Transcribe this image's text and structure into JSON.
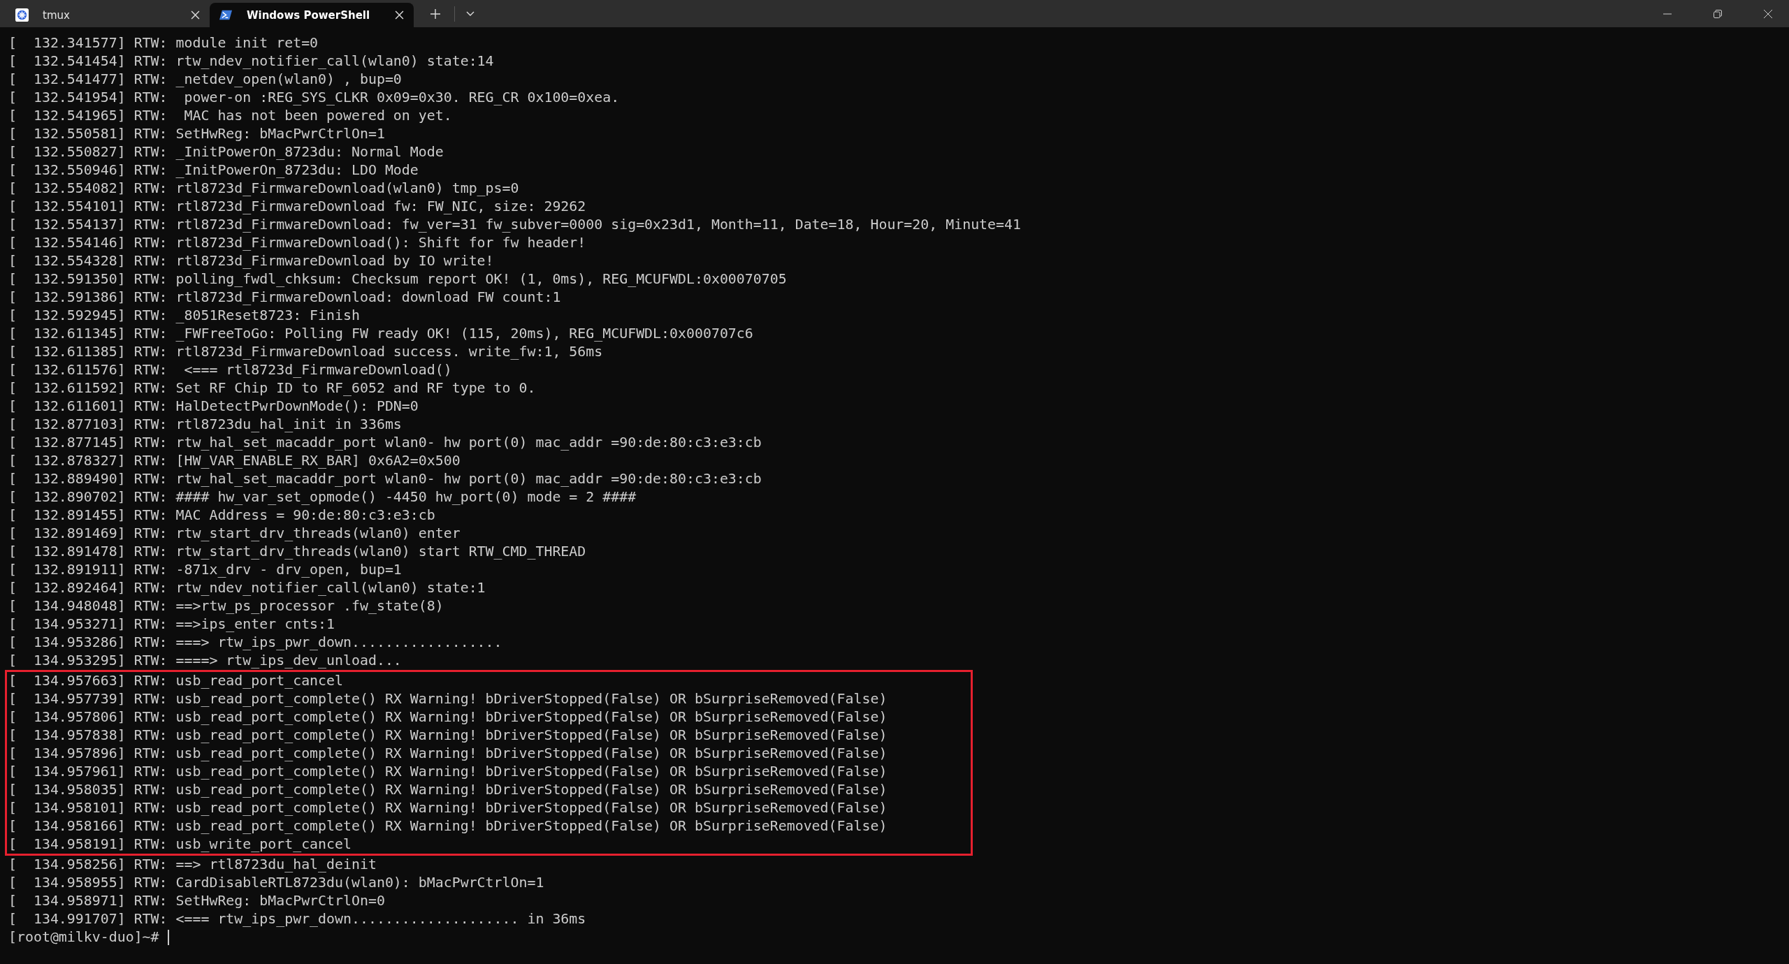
{
  "tabs": [
    {
      "kind": "tmux",
      "label": "tmux",
      "selected": false
    },
    {
      "kind": "powershell",
      "label": "Windows PowerShell",
      "selected": true
    }
  ],
  "terminal": {
    "lines_before": [
      "[  132.341577] RTW: module init ret=0",
      "[  132.541454] RTW: rtw_ndev_notifier_call(wlan0) state:14",
      "[  132.541477] RTW: _netdev_open(wlan0) , bup=0",
      "[  132.541954] RTW:  power-on :REG_SYS_CLKR 0x09=0x30. REG_CR 0x100=0xea.",
      "[  132.541965] RTW:  MAC has not been powered on yet.",
      "[  132.550581] RTW: SetHwReg: bMacPwrCtrlOn=1",
      "[  132.550827] RTW: _InitPowerOn_8723du: Normal Mode",
      "[  132.550946] RTW: _InitPowerOn_8723du: LDO Mode",
      "[  132.554082] RTW: rtl8723d_FirmwareDownload(wlan0) tmp_ps=0",
      "[  132.554101] RTW: rtl8723d_FirmwareDownload fw: FW_NIC, size: 29262",
      "[  132.554137] RTW: rtl8723d_FirmwareDownload: fw_ver=31 fw_subver=0000 sig=0x23d1, Month=11, Date=18, Hour=20, Minute=41",
      "[  132.554146] RTW: rtl8723d_FirmwareDownload(): Shift for fw header!",
      "[  132.554328] RTW: rtl8723d_FirmwareDownload by IO write!",
      "[  132.591350] RTW: polling_fwdl_chksum: Checksum report OK! (1, 0ms), REG_MCUFWDL:0x00070705",
      "[  132.591386] RTW: rtl8723d_FirmwareDownload: download FW count:1",
      "[  132.592945] RTW: _8051Reset8723: Finish",
      "[  132.611345] RTW: _FWFreeToGo: Polling FW ready OK! (115, 20ms), REG_MCUFWDL:0x000707c6",
      "[  132.611385] RTW: rtl8723d_FirmwareDownload success. write_fw:1, 56ms",
      "[  132.611576] RTW:  <=== rtl8723d_FirmwareDownload()",
      "[  132.611592] RTW: Set RF Chip ID to RF_6052 and RF type to 0.",
      "[  132.611601] RTW: HalDetectPwrDownMode(): PDN=0",
      "[  132.877103] RTW: rtl8723du_hal_init in 336ms",
      "[  132.877145] RTW: rtw_hal_set_macaddr_port wlan0- hw port(0) mac_addr =90:de:80:c3:e3:cb",
      "[  132.878327] RTW: [HW_VAR_ENABLE_RX_BAR] 0x6A2=0x500",
      "[  132.889490] RTW: rtw_hal_set_macaddr_port wlan0- hw port(0) mac_addr =90:de:80:c3:e3:cb",
      "[  132.890702] RTW: #### hw_var_set_opmode() -4450 hw_port(0) mode = 2 ####",
      "[  132.891455] RTW: MAC Address = 90:de:80:c3:e3:cb",
      "[  132.891469] RTW: rtw_start_drv_threads(wlan0) enter",
      "[  132.891478] RTW: rtw_start_drv_threads(wlan0) start RTW_CMD_THREAD",
      "[  132.891911] RTW: -871x_drv - drv_open, bup=1",
      "[  132.892464] RTW: rtw_ndev_notifier_call(wlan0) state:1",
      "[  134.948048] RTW: ==>rtw_ps_processor .fw_state(8)",
      "[  134.953271] RTW: ==>ips_enter cnts:1",
      "[  134.953286] RTW: ===> rtw_ips_pwr_down..................",
      "[  134.953295] RTW: ====> rtw_ips_dev_unload..."
    ],
    "highlighted_lines": [
      "[  134.957663] RTW: usb_read_port_cancel",
      "[  134.957739] RTW: usb_read_port_complete() RX Warning! bDriverStopped(False) OR bSurpriseRemoved(False)",
      "[  134.957806] RTW: usb_read_port_complete() RX Warning! bDriverStopped(False) OR bSurpriseRemoved(False)",
      "[  134.957838] RTW: usb_read_port_complete() RX Warning! bDriverStopped(False) OR bSurpriseRemoved(False)",
      "[  134.957896] RTW: usb_read_port_complete() RX Warning! bDriverStopped(False) OR bSurpriseRemoved(False)",
      "[  134.957961] RTW: usb_read_port_complete() RX Warning! bDriverStopped(False) OR bSurpriseRemoved(False)",
      "[  134.958035] RTW: usb_read_port_complete() RX Warning! bDriverStopped(False) OR bSurpriseRemoved(False)",
      "[  134.958101] RTW: usb_read_port_complete() RX Warning! bDriverStopped(False) OR bSurpriseRemoved(False)",
      "[  134.958166] RTW: usb_read_port_complete() RX Warning! bDriverStopped(False) OR bSurpriseRemoved(False)",
      "[  134.958191] RTW: usb_write_port_cancel"
    ],
    "lines_after": [
      "[  134.958256] RTW: ==> rtl8723du_hal_deinit",
      "[  134.958955] RTW: CardDisableRTL8723du(wlan0): bMacPwrCtrlOn=1",
      "[  134.958971] RTW: SetHwReg: bMacPwrCtrlOn=0",
      "[  134.991707] RTW: <=== rtw_ips_pwr_down.................... in 36ms"
    ],
    "prompt": "[root@milkv-duo]~#"
  }
}
